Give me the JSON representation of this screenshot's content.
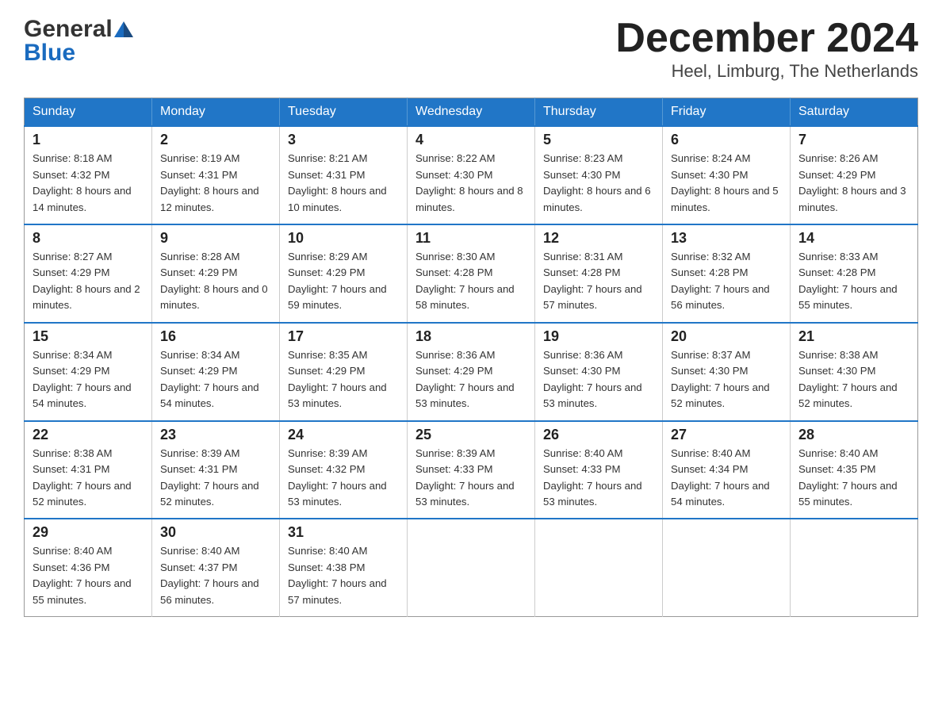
{
  "header": {
    "logo_line1": "General",
    "logo_line2": "Blue",
    "title": "December 2024",
    "subtitle": "Heel, Limburg, The Netherlands"
  },
  "calendar": {
    "days": [
      "Sunday",
      "Monday",
      "Tuesday",
      "Wednesday",
      "Thursday",
      "Friday",
      "Saturday"
    ],
    "weeks": [
      [
        {
          "day": "1",
          "sunrise": "Sunrise: 8:18 AM",
          "sunset": "Sunset: 4:32 PM",
          "daylight": "Daylight: 8 hours and 14 minutes."
        },
        {
          "day": "2",
          "sunrise": "Sunrise: 8:19 AM",
          "sunset": "Sunset: 4:31 PM",
          "daylight": "Daylight: 8 hours and 12 minutes."
        },
        {
          "day": "3",
          "sunrise": "Sunrise: 8:21 AM",
          "sunset": "Sunset: 4:31 PM",
          "daylight": "Daylight: 8 hours and 10 minutes."
        },
        {
          "day": "4",
          "sunrise": "Sunrise: 8:22 AM",
          "sunset": "Sunset: 4:30 PM",
          "daylight": "Daylight: 8 hours and 8 minutes."
        },
        {
          "day": "5",
          "sunrise": "Sunrise: 8:23 AM",
          "sunset": "Sunset: 4:30 PM",
          "daylight": "Daylight: 8 hours and 6 minutes."
        },
        {
          "day": "6",
          "sunrise": "Sunrise: 8:24 AM",
          "sunset": "Sunset: 4:30 PM",
          "daylight": "Daylight: 8 hours and 5 minutes."
        },
        {
          "day": "7",
          "sunrise": "Sunrise: 8:26 AM",
          "sunset": "Sunset: 4:29 PM",
          "daylight": "Daylight: 8 hours and 3 minutes."
        }
      ],
      [
        {
          "day": "8",
          "sunrise": "Sunrise: 8:27 AM",
          "sunset": "Sunset: 4:29 PM",
          "daylight": "Daylight: 8 hours and 2 minutes."
        },
        {
          "day": "9",
          "sunrise": "Sunrise: 8:28 AM",
          "sunset": "Sunset: 4:29 PM",
          "daylight": "Daylight: 8 hours and 0 minutes."
        },
        {
          "day": "10",
          "sunrise": "Sunrise: 8:29 AM",
          "sunset": "Sunset: 4:29 PM",
          "daylight": "Daylight: 7 hours and 59 minutes."
        },
        {
          "day": "11",
          "sunrise": "Sunrise: 8:30 AM",
          "sunset": "Sunset: 4:28 PM",
          "daylight": "Daylight: 7 hours and 58 minutes."
        },
        {
          "day": "12",
          "sunrise": "Sunrise: 8:31 AM",
          "sunset": "Sunset: 4:28 PM",
          "daylight": "Daylight: 7 hours and 57 minutes."
        },
        {
          "day": "13",
          "sunrise": "Sunrise: 8:32 AM",
          "sunset": "Sunset: 4:28 PM",
          "daylight": "Daylight: 7 hours and 56 minutes."
        },
        {
          "day": "14",
          "sunrise": "Sunrise: 8:33 AM",
          "sunset": "Sunset: 4:28 PM",
          "daylight": "Daylight: 7 hours and 55 minutes."
        }
      ],
      [
        {
          "day": "15",
          "sunrise": "Sunrise: 8:34 AM",
          "sunset": "Sunset: 4:29 PM",
          "daylight": "Daylight: 7 hours and 54 minutes."
        },
        {
          "day": "16",
          "sunrise": "Sunrise: 8:34 AM",
          "sunset": "Sunset: 4:29 PM",
          "daylight": "Daylight: 7 hours and 54 minutes."
        },
        {
          "day": "17",
          "sunrise": "Sunrise: 8:35 AM",
          "sunset": "Sunset: 4:29 PM",
          "daylight": "Daylight: 7 hours and 53 minutes."
        },
        {
          "day": "18",
          "sunrise": "Sunrise: 8:36 AM",
          "sunset": "Sunset: 4:29 PM",
          "daylight": "Daylight: 7 hours and 53 minutes."
        },
        {
          "day": "19",
          "sunrise": "Sunrise: 8:36 AM",
          "sunset": "Sunset: 4:30 PM",
          "daylight": "Daylight: 7 hours and 53 minutes."
        },
        {
          "day": "20",
          "sunrise": "Sunrise: 8:37 AM",
          "sunset": "Sunset: 4:30 PM",
          "daylight": "Daylight: 7 hours and 52 minutes."
        },
        {
          "day": "21",
          "sunrise": "Sunrise: 8:38 AM",
          "sunset": "Sunset: 4:30 PM",
          "daylight": "Daylight: 7 hours and 52 minutes."
        }
      ],
      [
        {
          "day": "22",
          "sunrise": "Sunrise: 8:38 AM",
          "sunset": "Sunset: 4:31 PM",
          "daylight": "Daylight: 7 hours and 52 minutes."
        },
        {
          "day": "23",
          "sunrise": "Sunrise: 8:39 AM",
          "sunset": "Sunset: 4:31 PM",
          "daylight": "Daylight: 7 hours and 52 minutes."
        },
        {
          "day": "24",
          "sunrise": "Sunrise: 8:39 AM",
          "sunset": "Sunset: 4:32 PM",
          "daylight": "Daylight: 7 hours and 53 minutes."
        },
        {
          "day": "25",
          "sunrise": "Sunrise: 8:39 AM",
          "sunset": "Sunset: 4:33 PM",
          "daylight": "Daylight: 7 hours and 53 minutes."
        },
        {
          "day": "26",
          "sunrise": "Sunrise: 8:40 AM",
          "sunset": "Sunset: 4:33 PM",
          "daylight": "Daylight: 7 hours and 53 minutes."
        },
        {
          "day": "27",
          "sunrise": "Sunrise: 8:40 AM",
          "sunset": "Sunset: 4:34 PM",
          "daylight": "Daylight: 7 hours and 54 minutes."
        },
        {
          "day": "28",
          "sunrise": "Sunrise: 8:40 AM",
          "sunset": "Sunset: 4:35 PM",
          "daylight": "Daylight: 7 hours and 55 minutes."
        }
      ],
      [
        {
          "day": "29",
          "sunrise": "Sunrise: 8:40 AM",
          "sunset": "Sunset: 4:36 PM",
          "daylight": "Daylight: 7 hours and 55 minutes."
        },
        {
          "day": "30",
          "sunrise": "Sunrise: 8:40 AM",
          "sunset": "Sunset: 4:37 PM",
          "daylight": "Daylight: 7 hours and 56 minutes."
        },
        {
          "day": "31",
          "sunrise": "Sunrise: 8:40 AM",
          "sunset": "Sunset: 4:38 PM",
          "daylight": "Daylight: 7 hours and 57 minutes."
        },
        null,
        null,
        null,
        null
      ]
    ]
  }
}
